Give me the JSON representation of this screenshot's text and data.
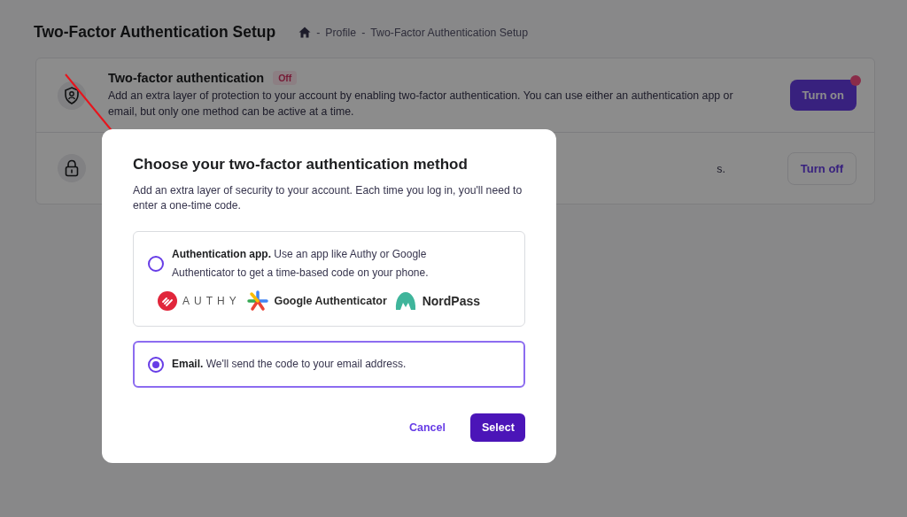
{
  "page": {
    "title": "Two-Factor Authentication Setup",
    "separator": "-",
    "breadcrumb": [
      "Profile",
      "Two-Factor Authentication Setup"
    ]
  },
  "settings": [
    {
      "kind": "shield",
      "title": "Two-factor authentication",
      "badge": "Off",
      "description": "Add an extra layer of protection to your account by enabling two-factor authentication. You can use either an authentication app or email, but only one method can be active at a time.",
      "button": "Turn on",
      "primary": true,
      "notification": true
    },
    {
      "kind": "lock",
      "description": "s.",
      "button": "Turn off",
      "primary": false,
      "notification": false
    }
  ],
  "dialog": {
    "title": "Choose your two-factor authentication method",
    "description": "Add an extra layer of security to your account. Each time you log in, you'll need to enter a one-time code.",
    "options": [
      {
        "text": "**Authentication app.** Use an app like Authy or Google Authenticator to get a time-based code on your phone.",
        "selected": false,
        "apps": [
          {
            "kind": "authy",
            "name": "AUTHY"
          },
          {
            "kind": "google",
            "name": "Google Authenticator"
          },
          {
            "kind": "nordpass",
            "name": "NordPass"
          }
        ]
      },
      {
        "text": "**Email.** We'll send the code to your email address.",
        "selected": true
      }
    ],
    "cancel": "Cancel",
    "confirm": "Select"
  }
}
